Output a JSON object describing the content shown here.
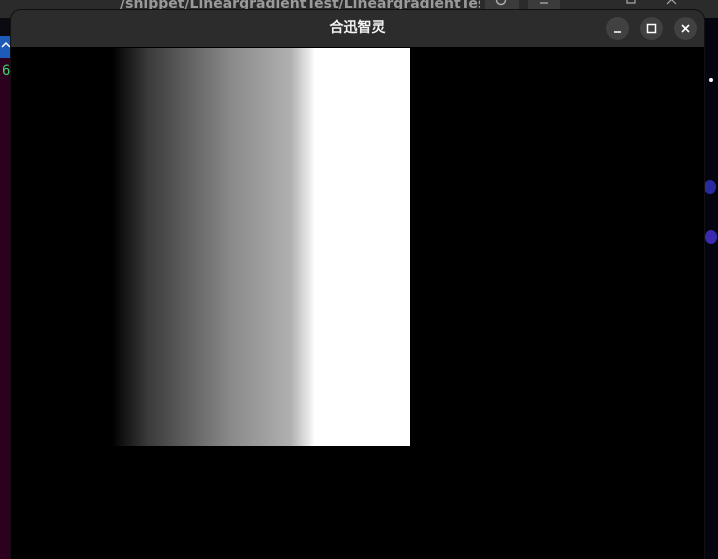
{
  "background": {
    "window_title": "/snippet/LineargradientTest/LineargradientTest",
    "terminal_digit": "6"
  },
  "window": {
    "title": "合迅智灵",
    "controls": {
      "minimize_icon": "minimize-icon",
      "maximize_icon": "maximize-icon",
      "close_icon": "close-icon"
    }
  },
  "canvas": {
    "gradient": {
      "direction": "left-to-right",
      "start_color": "#000000",
      "end_color": "#ffffff"
    }
  },
  "colors": {
    "titlebar": "#2c2c2c",
    "window_bg": "#000000",
    "title_text": "#f2f2f2"
  }
}
